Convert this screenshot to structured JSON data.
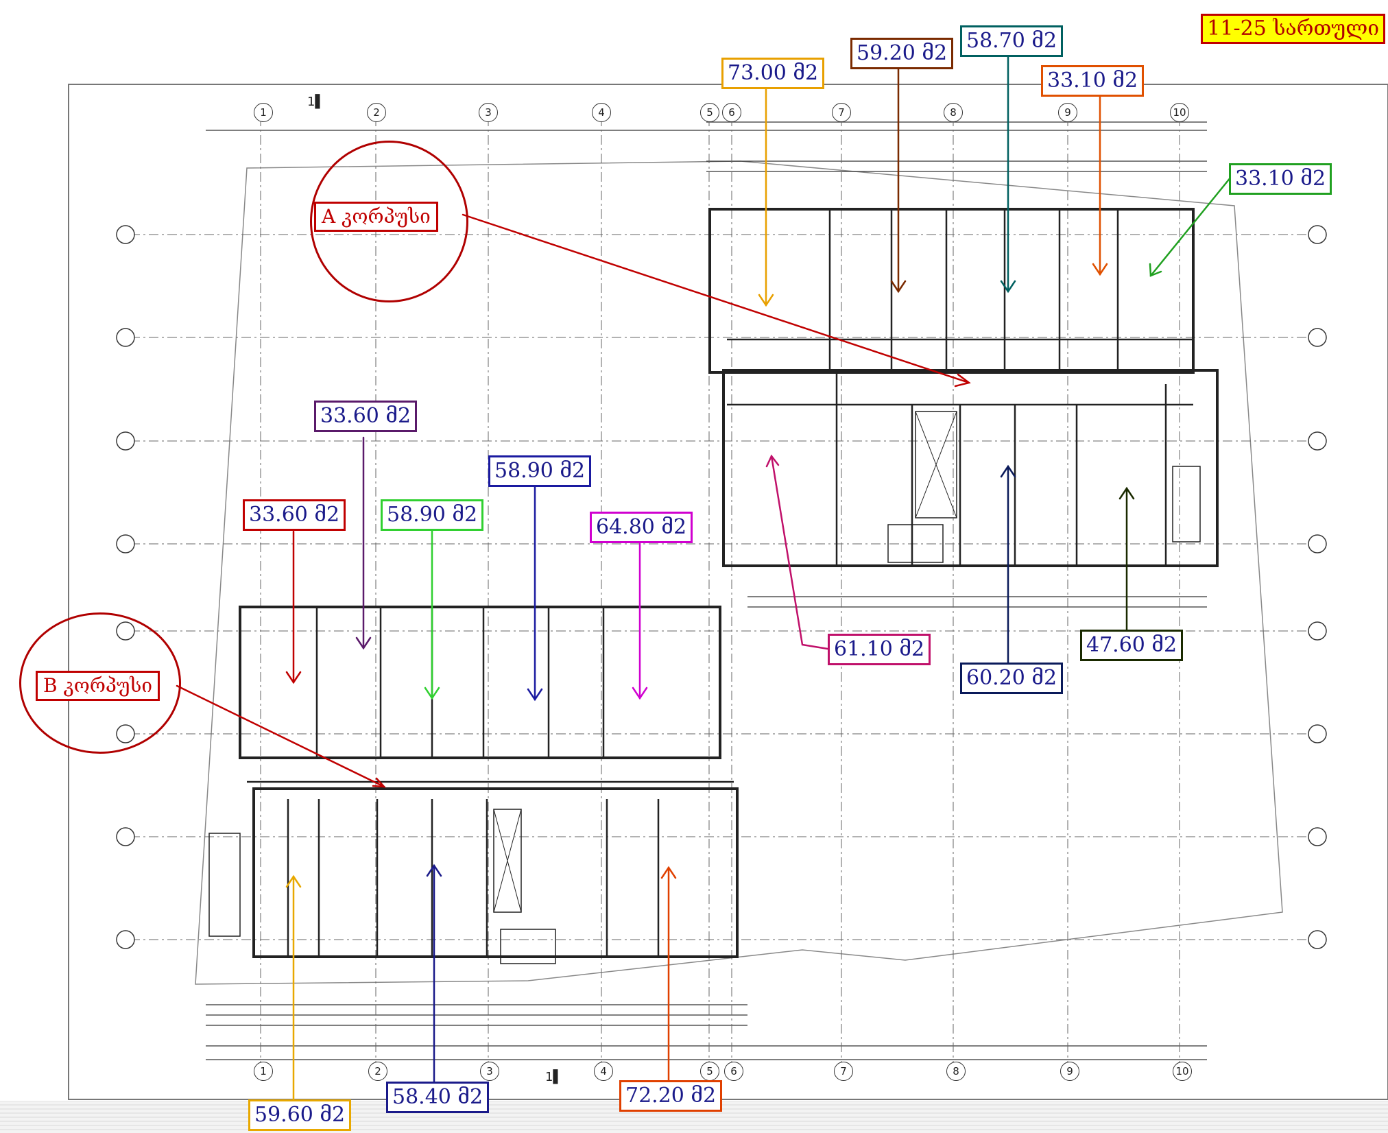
{
  "floor_label": "11-25 სართული",
  "blocks": [
    {
      "id": "A",
      "label": "A კორპუსი"
    },
    {
      "id": "B",
      "label": "B კორპუსი"
    }
  ],
  "areas": [
    {
      "id": "a1",
      "text": "73.00 მ2",
      "color": "#e8a000"
    },
    {
      "id": "a2",
      "text": "59.20 მ2",
      "color": "#7a2a00"
    },
    {
      "id": "a3",
      "text": "58.70 მ2",
      "color": "#006060"
    },
    {
      "id": "a4",
      "text": "33.10 მ2",
      "color": "#e05000"
    },
    {
      "id": "a5",
      "text": "33.10 მ2",
      "color": "#20a020"
    },
    {
      "id": "b1",
      "text": "33.60 მ2",
      "color": "#5a1a6a"
    },
    {
      "id": "b2",
      "text": "33.60 მ2",
      "color": "#c00000"
    },
    {
      "id": "b3",
      "text": "58.90 მ2",
      "color": "#30d030"
    },
    {
      "id": "b4",
      "text": "58.90 მ2",
      "color": "#1a1aa0"
    },
    {
      "id": "b5",
      "text": "64.80 მ2",
      "color": "#d000d0"
    },
    {
      "id": "c1",
      "text": "61.10 მ2",
      "color": "#c0106a"
    },
    {
      "id": "c2",
      "text": "60.20 მ2",
      "color": "#0a1a5a"
    },
    {
      "id": "c3",
      "text": "47.60 მ2",
      "color": "#1a2a00"
    },
    {
      "id": "d1",
      "text": "59.60 მ2",
      "color": "#e8a800"
    },
    {
      "id": "d2",
      "text": "58.40 მ2",
      "color": "#1a1a8a"
    },
    {
      "id": "d3",
      "text": "72.20 მ2",
      "color": "#e04000"
    }
  ],
  "grid_axes": [
    "1",
    "2",
    "3",
    "4",
    "5",
    "6",
    "7",
    "8",
    "9",
    "10"
  ],
  "sheet_mark": "1"
}
